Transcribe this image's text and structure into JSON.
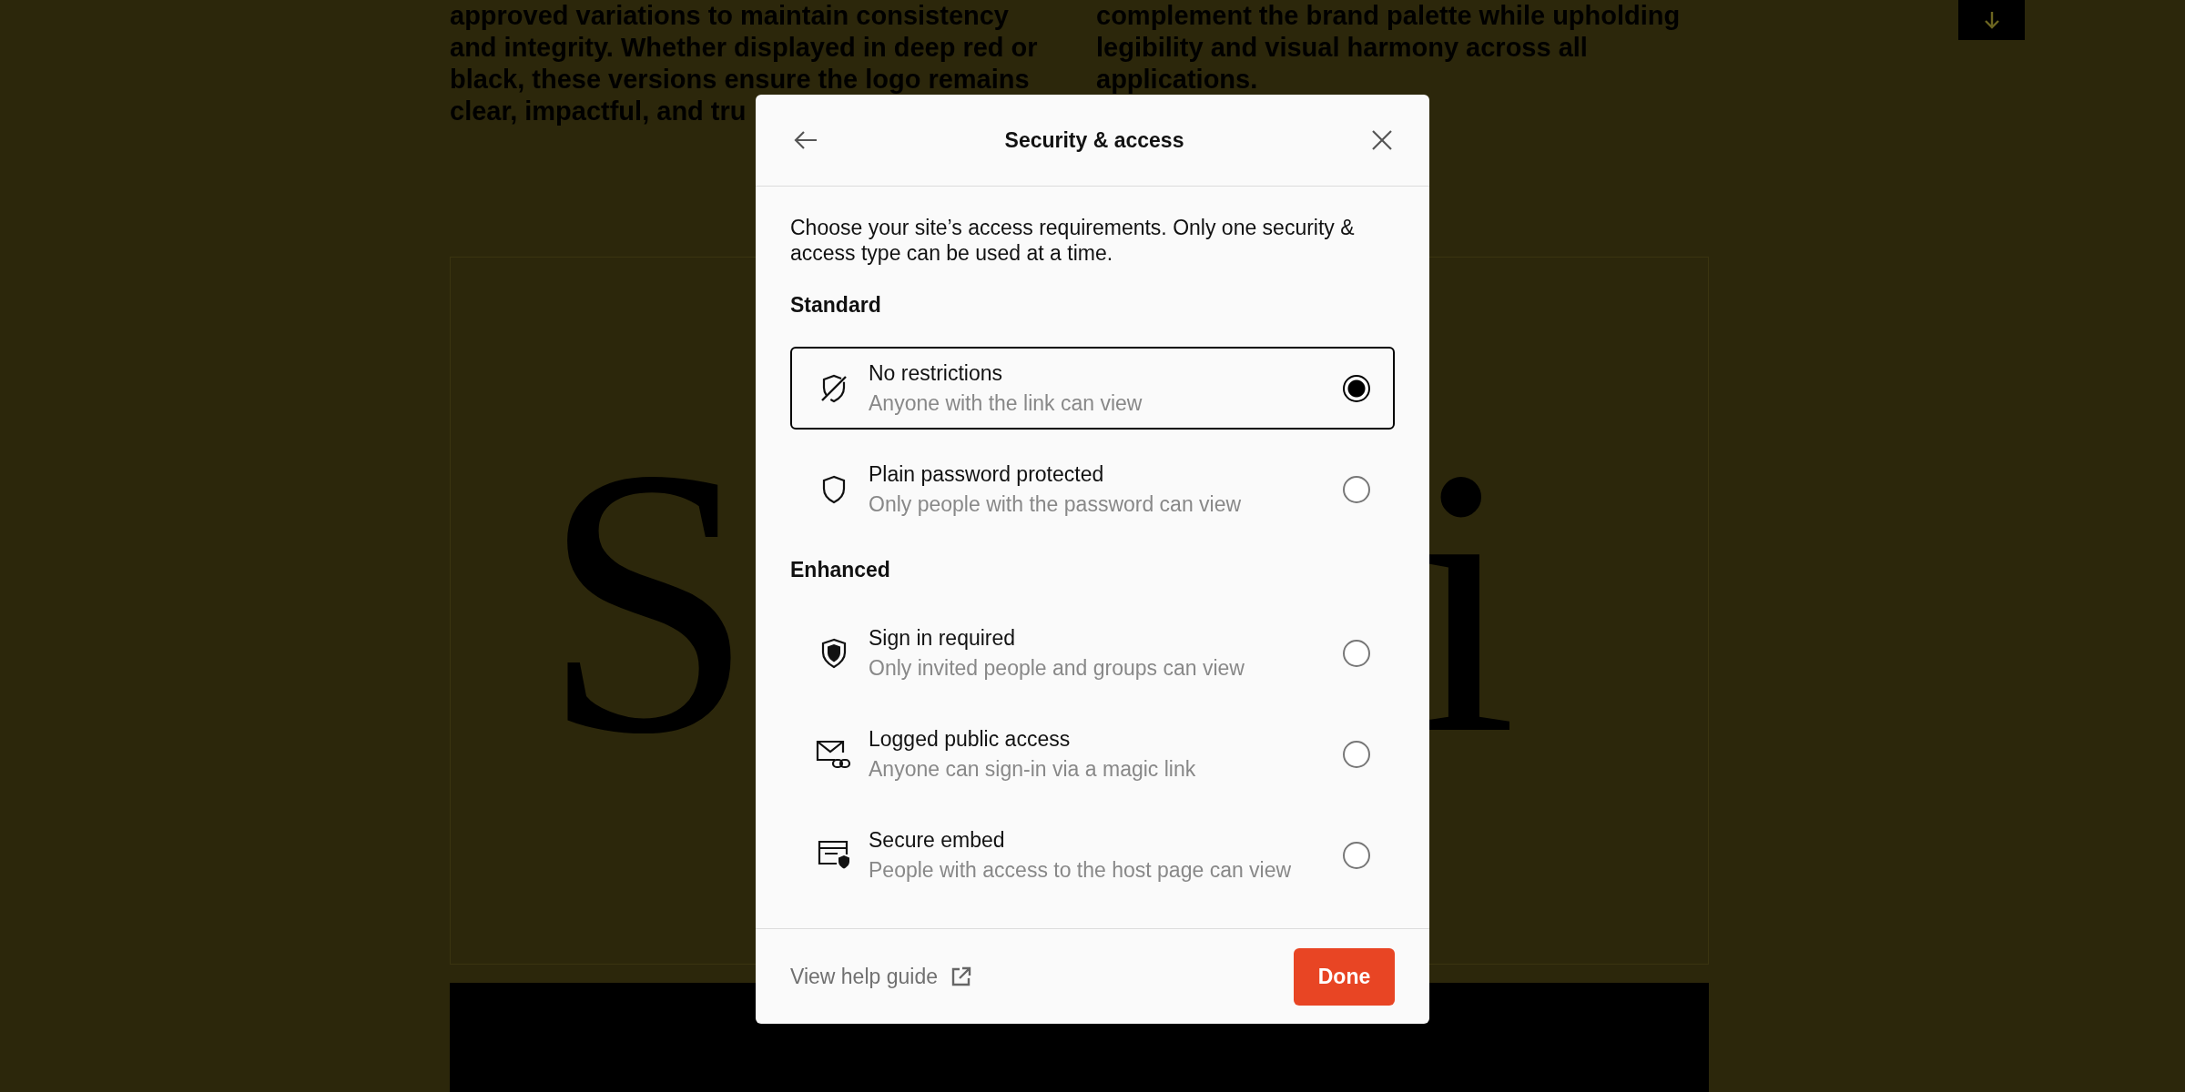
{
  "background": {
    "left_lines": [
      "approved variations to maintain consistency",
      "and integrity. Whether displayed in deep red or",
      "black, these versions ensure the logo remains",
      "clear, impactful, and tru"
    ],
    "right_lines": [
      "complement the brand palette while upholding",
      "legibility and visual harmony across all",
      "applications."
    ],
    "display_letters": [
      "S",
      "i"
    ]
  },
  "dialog": {
    "title": "Security & access",
    "description": "Choose your site’s access requirements. Only one security & access type can be used at a time.",
    "sections": [
      {
        "heading": "Standard",
        "options": [
          {
            "title": "No restrictions",
            "subtitle": "Anyone with the link can view",
            "selected": true
          },
          {
            "title": "Plain password protected",
            "subtitle": "Only people with the password can view",
            "selected": false
          }
        ]
      },
      {
        "heading": "Enhanced",
        "options": [
          {
            "title": "Sign in required",
            "subtitle": "Only invited people and groups can view",
            "selected": false
          },
          {
            "title": "Logged public access",
            "subtitle": "Anyone can sign-in via a magic link",
            "selected": false
          },
          {
            "title": "Secure embed",
            "subtitle": "People with access to the host page can view",
            "selected": false
          }
        ]
      }
    ],
    "help_link": "View help guide",
    "done_button": "Done"
  }
}
